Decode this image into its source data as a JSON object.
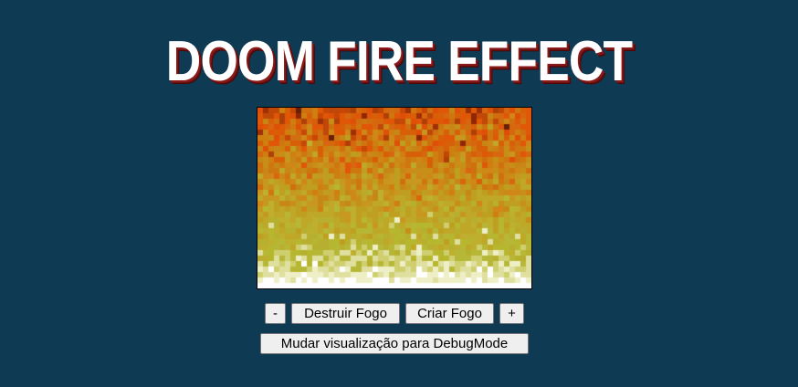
{
  "page": {
    "title": "DOOM FIRE EFFECT"
  },
  "fire": {
    "palette": [
      "#070707",
      "#1f0707",
      "#2f0f07",
      "#470f07",
      "#571707",
      "#671f07",
      "#771f07",
      "#8f2707",
      "#9f2f07",
      "#af3f07",
      "#bf4707",
      "#c74707",
      "#df4f07",
      "#df5707",
      "#df5707",
      "#d75f07",
      "#d7670f",
      "#cf6f0f",
      "#cf770f",
      "#cf7f0f",
      "#cf8717",
      "#c78717",
      "#c78f17",
      "#c7971f",
      "#bf9f1f",
      "#bf9f1f",
      "#bfa727",
      "#bfa727",
      "#bfaf2f",
      "#b7af2f",
      "#b7b72f",
      "#b7b737",
      "#cfcf6f",
      "#dfdf9f",
      "#efefc7",
      "#ffffff"
    ]
  },
  "controls": {
    "decrease_label": "-",
    "destroy_label": "Destruir Fogo",
    "create_label": "Criar Fogo",
    "increase_label": "+",
    "debug_label": "Mudar visualização para DebugMode"
  }
}
